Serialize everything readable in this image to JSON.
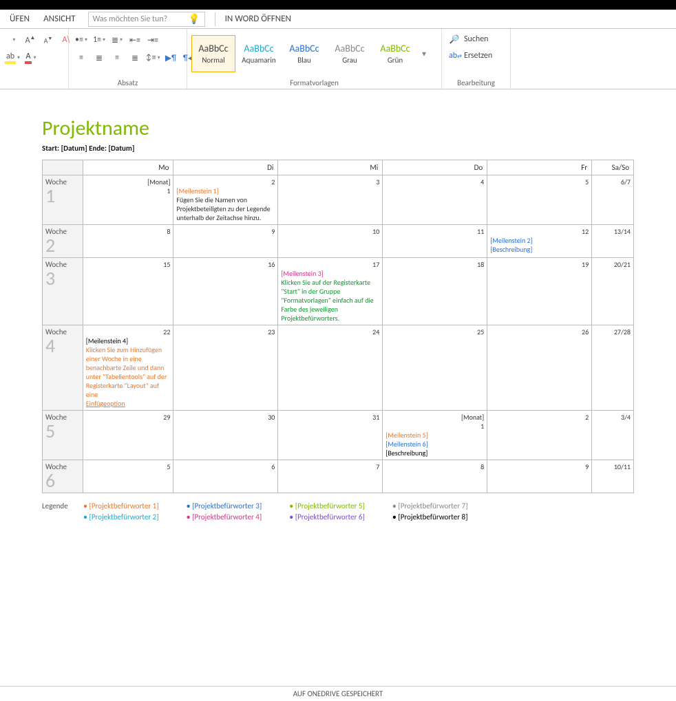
{
  "tabs": {
    "uefen": "ÜFEN",
    "ansicht": "ANSICHT"
  },
  "tellme": {
    "placeholder": "Was möchten Sie tun?"
  },
  "openWord": "IN WORD ÖFFNEN",
  "groups": {
    "absatz": "Absatz",
    "formatvorlagen": "Formatvorlagen",
    "bearbeitung": "Bearbeitung"
  },
  "styles": {
    "normal": {
      "sample": "AaBbCc",
      "name": "Normal"
    },
    "aqua": {
      "sample": "AaBbCc",
      "name": "Aquamarin"
    },
    "blau": {
      "sample": "AaBbCc",
      "name": "Blau"
    },
    "grau": {
      "sample": "AaBbCc",
      "name": "Grau"
    },
    "gruen": {
      "sample": "AaBbCc",
      "name": "Grün"
    }
  },
  "editing": {
    "suchen": "Suchen",
    "ersetzen": "Ersetzen"
  },
  "doc": {
    "title": "Projektname",
    "dates": "Start: [Datum]  Ende: [Datum]",
    "headers": {
      "wk": "",
      "mo": "Mo",
      "di": "Di",
      "mi": "Mi",
      "do": "Do",
      "fr": "Fr",
      "sa": "Sa/So"
    },
    "weeks": [
      {
        "label": "Woche",
        "num": "1",
        "cells": [
          {
            "num": "[Monat]\n1"
          },
          {
            "num": "2",
            "lines": [
              {
                "t": "[Meilenstein 1]",
                "c": "c-orange"
              },
              {
                "t": "Fügen Sie die Namen von Projektbeteiligten zu der Legende unterhalb der Zeitachse hinzu.",
                "c": ""
              }
            ]
          },
          {
            "num": "3"
          },
          {
            "num": "4"
          },
          {
            "num": "5"
          },
          {
            "num": "6/7"
          }
        ]
      },
      {
        "label": "Woche",
        "num": "2",
        "cells": [
          {
            "num": "8"
          },
          {
            "num": "9"
          },
          {
            "num": "10"
          },
          {
            "num": "11"
          },
          {
            "num": "12",
            "lines": [
              {
                "t": "[Meilenstein 2]",
                "c": "c-blue"
              },
              {
                "t": "[Beschreibung]",
                "c": "c-blue"
              }
            ]
          },
          {
            "num": "13/14"
          }
        ]
      },
      {
        "label": "Woche",
        "num": "3",
        "tall": true,
        "cells": [
          {
            "num": "15"
          },
          {
            "num": "16"
          },
          {
            "num": "17",
            "lines": [
              {
                "t": "[Meilenstein 3]",
                "c": "c-magenta"
              },
              {
                "t": "Klicken Sie auf der Registerkarte \"Start\" in der Gruppe \"Formatvorlagen\" einfach auf die Farbe des jeweiligen Projektbefürworters.",
                "c": "c-green"
              }
            ]
          },
          {
            "num": "18"
          },
          {
            "num": "19"
          },
          {
            "num": "20/21"
          }
        ]
      },
      {
        "label": "Woche",
        "num": "4",
        "vtall": true,
        "cells": [
          {
            "num": "22",
            "lines": [
              {
                "t": "[Meilenstein 4]",
                "c": "c-black"
              },
              {
                "t": "Klicken Sie zum Hinzufügen einer Woche in eine benachbarte Zeile und dann unter \"Tabellentools\" auf der Registerkarte \"Layout\" auf eine",
                "c": "c-orange"
              },
              {
                "t": "Einfügeoption",
                "c": "c-orange und"
              }
            ]
          },
          {
            "num": "23"
          },
          {
            "num": "24"
          },
          {
            "num": "25"
          },
          {
            "num": "26"
          },
          {
            "num": "27/28"
          }
        ]
      },
      {
        "label": "Woche",
        "num": "5",
        "cells": [
          {
            "num": "29"
          },
          {
            "num": "30"
          },
          {
            "num": "31"
          },
          {
            "num": "[Monat]\n1",
            "lines": [
              {
                "t": "[Meilenstein 5]",
                "c": "c-orange"
              },
              {
                "t": "[Meilenstein 6]",
                "c": "c-blue"
              },
              {
                "t": "[Beschreibung]",
                "c": "c-black"
              }
            ]
          },
          {
            "num": "2"
          },
          {
            "num": "3/4"
          }
        ]
      },
      {
        "label": "Woche",
        "num": "6",
        "cells": [
          {
            "num": "5"
          },
          {
            "num": "6"
          },
          {
            "num": "7"
          },
          {
            "num": "8"
          },
          {
            "num": "9"
          },
          {
            "num": "10/11"
          }
        ]
      }
    ],
    "legend": {
      "label": "Legende",
      "cols": [
        [
          {
            "t": "[Projektbefürworter 1]",
            "c": "c-orange"
          },
          {
            "t": "[Projektbefürworter 2]",
            "c": "c-teal"
          }
        ],
        [
          {
            "t": "[Projektbefürworter 3]",
            "c": "c-blue"
          },
          {
            "t": "[Projektbefürworter 4]",
            "c": "c-magenta"
          }
        ],
        [
          {
            "t": "[Projektbefürworter 5]",
            "c": "c-lime"
          },
          {
            "t": "[Projektbefürworter 6]",
            "c": "c-purple"
          }
        ],
        [
          {
            "t": "[Projektbefürworter 7]",
            "c": "c-grey"
          },
          {
            "t": "[Projektbefürworter 8]",
            "c": "c-black"
          }
        ]
      ]
    }
  },
  "status": "AUF ONEDRIVE GESPEICHERT"
}
